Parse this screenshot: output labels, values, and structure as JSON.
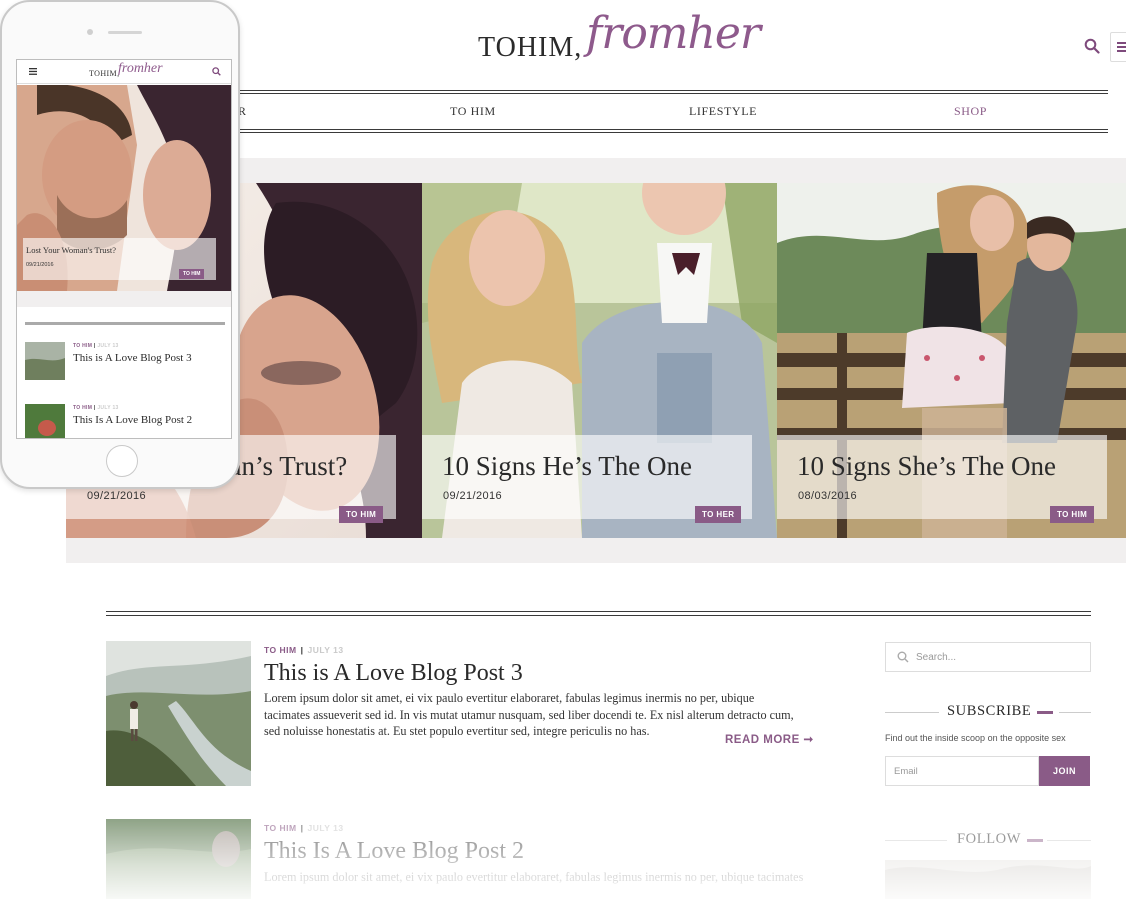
{
  "site": {
    "logo_main": "TOHIM,",
    "logo_script": "fromher"
  },
  "header": {
    "search_icon": "search-icon",
    "menu_icon": "hamburger-menu-icon"
  },
  "nav": {
    "items": [
      {
        "label": "R"
      },
      {
        "label": "TO HIM"
      },
      {
        "label": "LIFESTYLE"
      },
      {
        "label": "SHOP"
      }
    ],
    "active_color": "#8a5b87"
  },
  "slides": [
    {
      "title": "nan’s Trust?",
      "date": "09/21/2016",
      "tag": "TO HIM"
    },
    {
      "title": "10 Signs He’s The One",
      "date": "09/21/2016",
      "tag": "TO HER"
    },
    {
      "title": "10 Signs She’s The One",
      "date": "08/03/2016",
      "tag": "TO HIM"
    }
  ],
  "posts": [
    {
      "category": "TO HIM",
      "date": "JULY 13",
      "title": "This is A Love Blog Post 3",
      "excerpt": "Lorem ipsum dolor sit amet, ei vix paulo evertitur elaboraret, fabulas legimus inermis no per, ubique tacimates assueverit sed id. In vis mutat utamur nusquam, sed liber docendi te. Ex nisl alterum detracto cum, sed noluisse honestatis at. Eu stet populo evertitur sed, integre periculis no has.",
      "read_more": "READ MORE ➞"
    },
    {
      "category": "TO HIM",
      "date": "JULY 13",
      "title": "This Is A Love Blog Post 2",
      "excerpt": "Lorem ipsum dolor sit amet, ei vix paulo evertitur elaboraret, fabulas legimus inermis no per, ubique tacimates"
    }
  ],
  "sidebar": {
    "search_placeholder": "Search...",
    "subscribe_heading": "SUBSCRIBE",
    "subscribe_note": "Find out the inside scoop on the opposite sex",
    "email_placeholder": "Email",
    "join_label": "JOIN",
    "follow_heading": "FOLLOW"
  },
  "phone": {
    "logo_main": "TOHIM,",
    "logo_script": "fromher",
    "hero_title": "Lost Your Woman's Trust?",
    "hero_date": "09/21/2016",
    "hero_tag": "TO HIM",
    "posts": [
      {
        "category": "TO HIM",
        "date": "JULY 13",
        "title": "This is A Love Blog Post 3"
      },
      {
        "category": "TO HIM",
        "date": "JULY 13",
        "title": "This Is A Love Blog Post 2"
      }
    ]
  },
  "colors": {
    "accent": "#8a5b87",
    "logo_script": "#8e5a8c",
    "band": "#f1efef"
  }
}
